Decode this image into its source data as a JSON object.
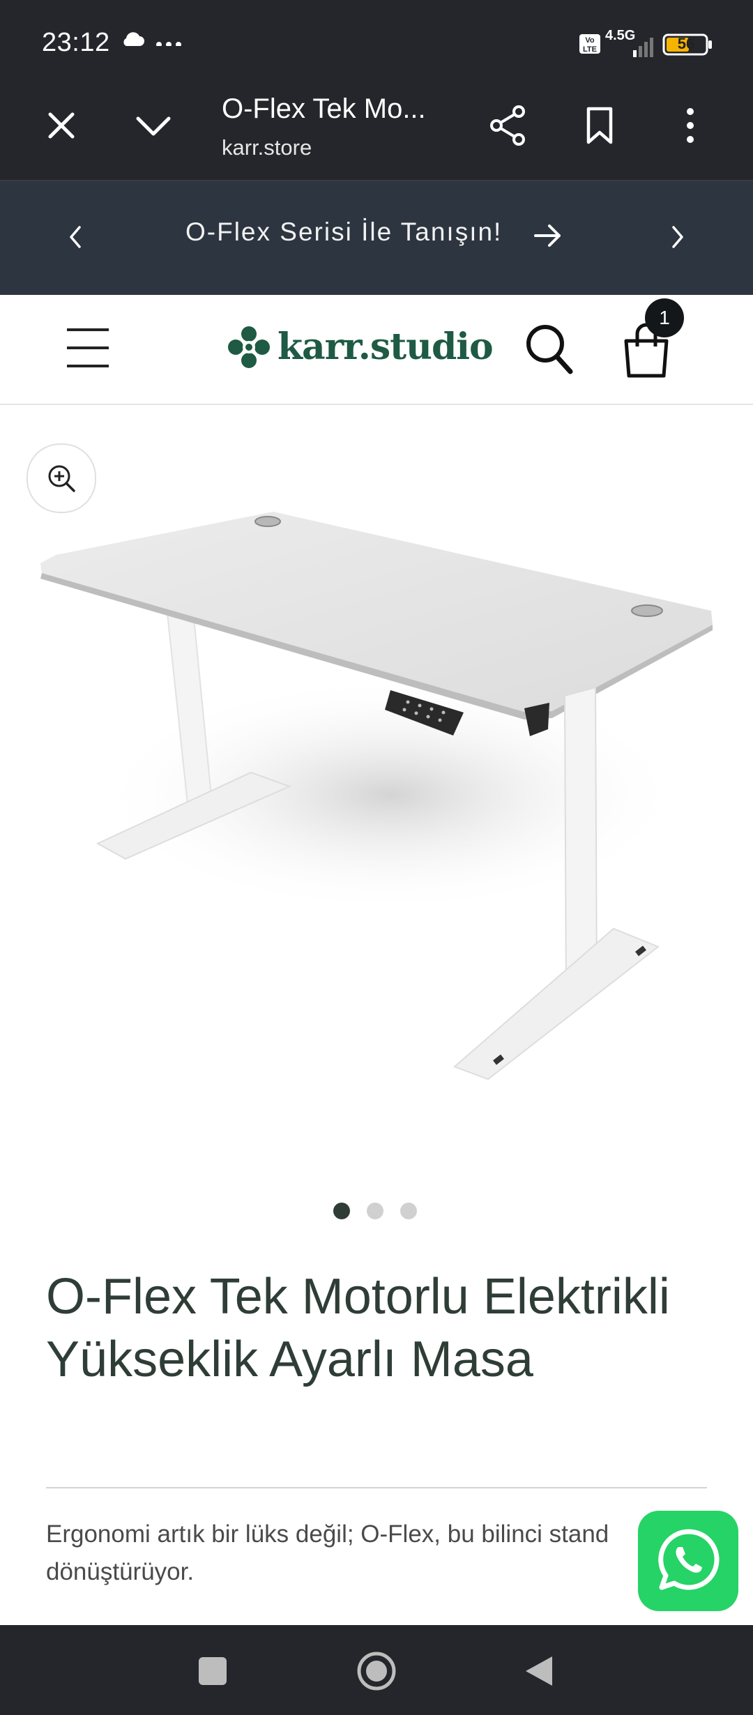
{
  "status_bar": {
    "time": "23:12",
    "network": "4.5G",
    "battery": "56",
    "icons": [
      "cloud-icon",
      "more-dots-icon",
      "volte-icon",
      "signal-icon",
      "battery-icon"
    ]
  },
  "browser_bar": {
    "title": "O-Flex Tek Mo...",
    "url": "karr.store",
    "icons": [
      "close-icon",
      "chevron-down-icon",
      "share-icon",
      "bookmark-icon",
      "kebab-menu-icon"
    ]
  },
  "banner": {
    "text": "O-Flex Serisi İle Tanışın!",
    "icons": [
      "chevron-left-icon",
      "arrow-right-icon",
      "chevron-right-icon"
    ]
  },
  "site_header": {
    "brand": "karr.studio",
    "cart_count": "1",
    "icons": [
      "hamburger-menu-icon",
      "logo-flower-icon",
      "search-icon",
      "shopping-bag-icon"
    ]
  },
  "gallery": {
    "slide_count": 3,
    "active_slide": 1,
    "icons": [
      "zoom-in-icon"
    ]
  },
  "product": {
    "title": "O-Flex Tek Motorlu Elektrikli Yükseklik Ayarlı Masa",
    "description": "Ergonomi artık bir lüks değil; O-Flex, bu bilinci stand dönüştürüyor."
  },
  "colors": {
    "dark_bar": "#24262b",
    "banner_bg": "#2d3540",
    "brand_green": "#1e5a44",
    "title_color": "#2f3d37",
    "whatsapp": "#25d366"
  },
  "floating": {
    "icons": [
      "whatsapp-icon"
    ]
  },
  "nav_bar": {
    "icons": [
      "recents-square-icon",
      "home-circle-icon",
      "back-triangle-icon"
    ]
  }
}
